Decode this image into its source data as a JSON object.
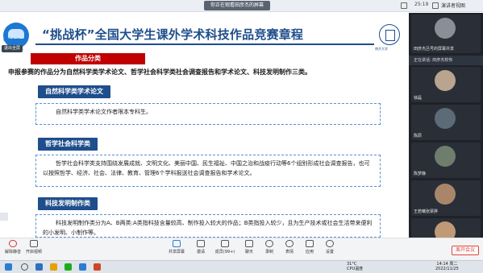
{
  "topbar": {
    "share_banner": "你正在观看田彦杰的屏幕",
    "timer": "25:19",
    "speaker_view": "演讲者视图"
  },
  "slide": {
    "logo_text": "腾讯会议",
    "exit_fullscreen": "退出全屏",
    "title": "“挑战杯”全国大学生课外学术科技作品竞赛章程",
    "university": "南开大学",
    "section_tag": "作品分类",
    "intro": "申报参赛的作品分为自然科学类学术论文、哲学社会科学类社会调查报告和学术论文、科技发明制作三类。",
    "categories": [
      {
        "tab": "自然科学类学术论文",
        "text": "自然科学类学术论文作者限本专科生。"
      },
      {
        "tab": "哲学社会科学类",
        "text": "哲学社会科学类支持围绕发展成就、文明文化、美丽中国、民生福祉、中国之治和战疫行动等6个组别形成社会调查报告，也可以按照哲学、经济、社会、法律、教育、管理6个学科报送社会调查报告和学术论文。"
      },
      {
        "tab": "科技发明制作类",
        "text": "科技发明制作类分为A、B两类:A类指科技含量较高、制作投入较大的作品；B类指投入较少，且为生产技术或社会生活带来便利的小发明、小制作等。"
      }
    ]
  },
  "panel": {
    "speaking_tip": "正在讲话: 田彦杰校你",
    "participants": [
      {
        "name": "田彦杰吕号的屏幕共享"
      },
      {
        "name": "徐磊"
      },
      {
        "name": "陈辰"
      },
      {
        "name": "陈梦静"
      },
      {
        "name": "王若曦张梁骅"
      },
      {
        "name": ""
      }
    ]
  },
  "toolbar": {
    "items": [
      {
        "label": "解除静音"
      },
      {
        "label": "开启视频"
      },
      {
        "label": "共享屏幕"
      },
      {
        "label": "邀请"
      },
      {
        "label": "成员(99+)"
      },
      {
        "label": "聊天"
      },
      {
        "label": "录制"
      },
      {
        "label": "表情"
      },
      {
        "label": "应用"
      },
      {
        "label": "设置"
      }
    ],
    "end_meeting": "离开会议"
  },
  "taskbar": {
    "temperature": "31°C",
    "cpu": "CPU温度",
    "time": "14:14 周二",
    "date": "2022/11/25"
  },
  "colors": {
    "title_blue": "#1f4e8c",
    "tag_red": "#c00000",
    "box_border": "#5a8fd0"
  }
}
